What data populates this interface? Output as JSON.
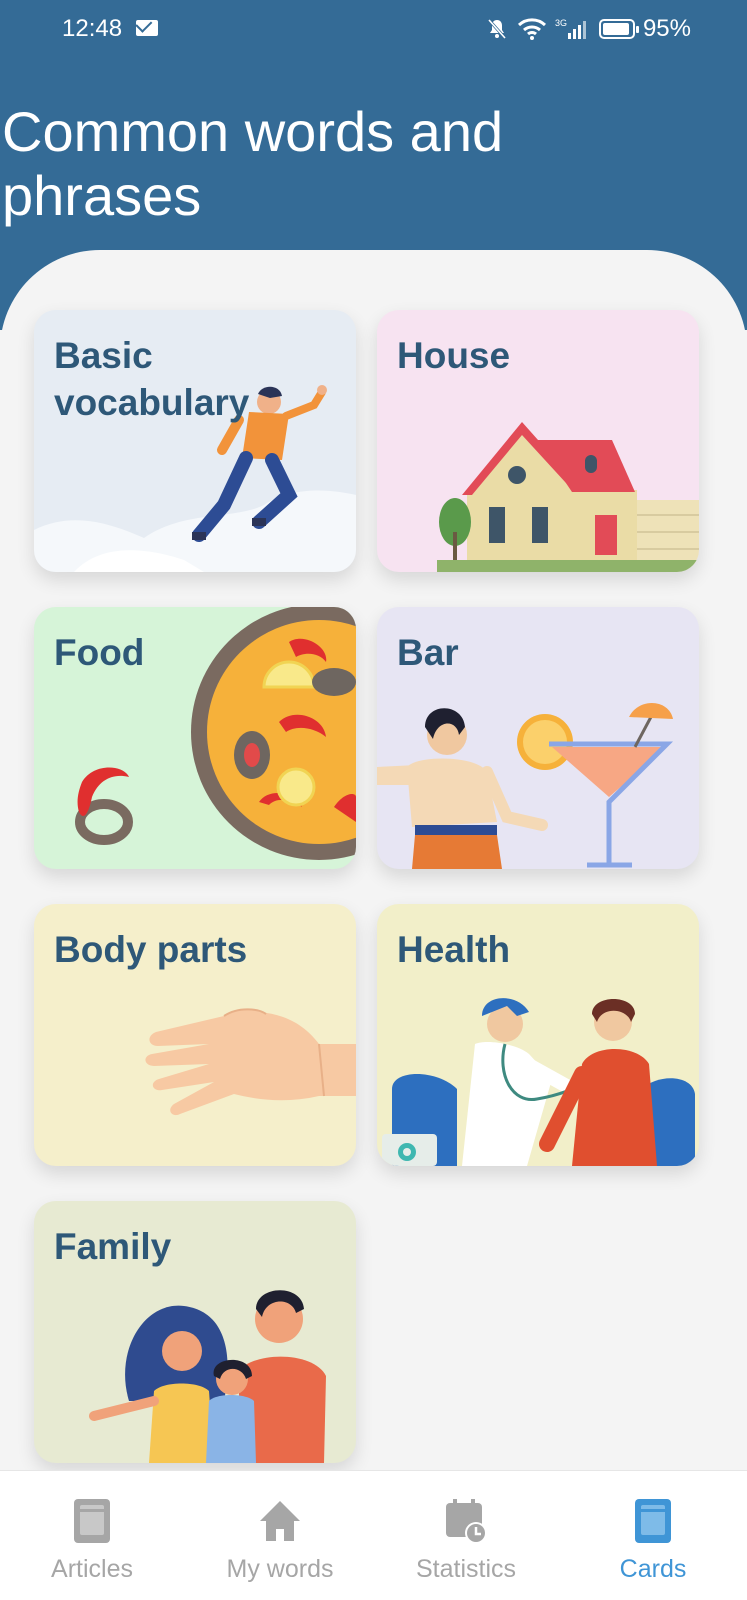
{
  "status_bar": {
    "time": "12:48",
    "battery": "95%",
    "icons": [
      "mail-icon",
      "bell-muted-icon",
      "wifi-icon",
      "3g-signal-icon",
      "battery-icon"
    ]
  },
  "page": {
    "title": "Common words and phrases"
  },
  "cards": [
    {
      "title": "Basic vocabulary",
      "background": "#e6ecf3",
      "icon": "flying-boy-illustration"
    },
    {
      "title": "House",
      "background": "#f7e3f1",
      "icon": "house-illustration"
    },
    {
      "title": "Food",
      "background": "#d6f4d8",
      "icon": "paella-illustration"
    },
    {
      "title": "Bar",
      "background": "#e7e5f3",
      "icon": "cocktail-illustration"
    },
    {
      "title": "Body parts",
      "background": "#f5efcb",
      "icon": "hand-illustration"
    },
    {
      "title": "Health",
      "background": "#f2efc9",
      "icon": "doctor-illustration"
    },
    {
      "title": "Family",
      "background": "#e7ead2",
      "icon": "family-illustration"
    }
  ],
  "tabbar": {
    "items": [
      {
        "label": "Articles",
        "icon": "book-icon",
        "active": false
      },
      {
        "label": "My words",
        "icon": "home-icon",
        "active": false
      },
      {
        "label": "Statistics",
        "icon": "calendar-clock-icon",
        "active": false
      },
      {
        "label": "Cards",
        "icon": "card-book-icon",
        "active": true
      }
    ]
  },
  "colors": {
    "header": "#346b96",
    "card_title": "#2e5878",
    "tab_active": "#3f95d6",
    "tab_inactive": "#a6a6a6"
  }
}
